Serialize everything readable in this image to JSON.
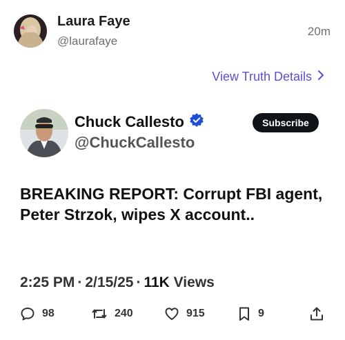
{
  "truth": {
    "user_name": "Laura Faye",
    "user_handle": "@laurafaye",
    "time_ago": "20m",
    "view_details_label": "View Truth Details",
    "link_color": "#5b4fd6"
  },
  "embedded_post": {
    "author_name": "Chuck Callesto",
    "author_handle": "@ChuckCallesto",
    "verified_icon": "verified-badge-icon",
    "verified_color": "#1d4ed8",
    "subscribe_label": "Subscribe",
    "text": "BREAKING REPORT: Corrupt FBI agent, Peter Strzok, wipes X account..",
    "time": "2:25 PM",
    "date": "2/15/25",
    "views_count": "11K",
    "views_label": "Views",
    "replies": "98",
    "reposts": "240",
    "likes": "915",
    "bookmarks": "9"
  }
}
